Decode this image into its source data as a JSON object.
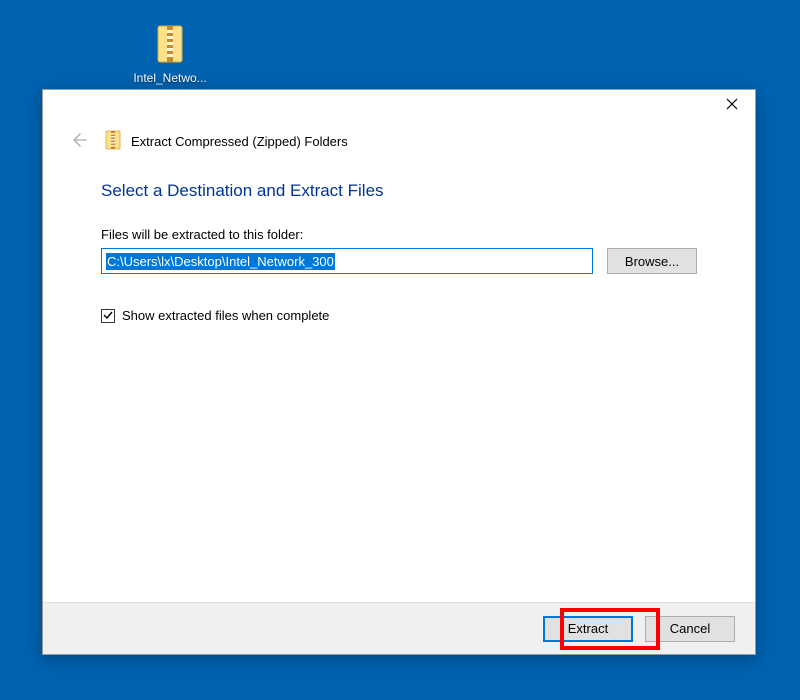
{
  "desktop": {
    "icon_label": "Intel_Netwo..."
  },
  "dialog": {
    "title": "Extract Compressed (Zipped) Folders",
    "heading": "Select a Destination and Extract Files",
    "path_label": "Files will be extracted to this folder:",
    "path_value": "C:\\Users\\lx\\Desktop\\Intel_Network_300",
    "browse_label": "Browse...",
    "checkbox_label": "Show extracted files when complete",
    "checkbox_checked": true,
    "footer": {
      "extract_label": "Extract",
      "cancel_label": "Cancel"
    }
  }
}
